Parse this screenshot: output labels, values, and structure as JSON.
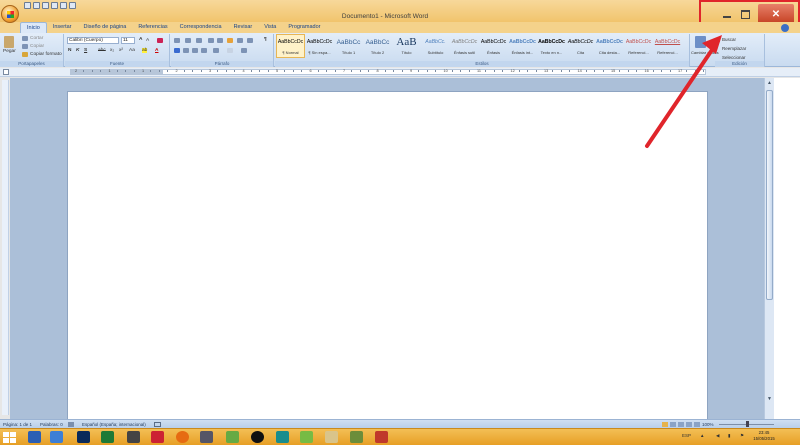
{
  "window": {
    "title": "Documento1 - Microsoft Word",
    "close_glyph": "✕"
  },
  "tabs": [
    "Inicio",
    "Insertar",
    "Diseño de página",
    "Referencias",
    "Correspondencia",
    "Revisar",
    "Vista",
    "Programador"
  ],
  "ribbon": {
    "clipboard": {
      "paste": "Pegar",
      "cut": "Cortar",
      "copy": "Copiar",
      "format_painter": "Copiar formato",
      "label": "Portapapeles"
    },
    "font": {
      "name": "Calibri (Cuerpo)",
      "size": "11",
      "label": "Fuente",
      "grow": "A",
      "shrink": "A",
      "bold": "N",
      "italic": "K",
      "underline": "S",
      "strike": "abc",
      "sub": "x₂",
      "sup": "x²",
      "case": "Aa",
      "highlight": "ab",
      "color": "A"
    },
    "paragraph": {
      "label": "Párrafo",
      "show_marks": "¶"
    },
    "styles": {
      "label": "Estilos",
      "items": [
        {
          "preview": "AaBbCcDc",
          "name": "¶ Normal"
        },
        {
          "preview": "AaBbCcDc",
          "name": "¶ Sin espa..."
        },
        {
          "preview": "AaBbCc",
          "name": "Título 1"
        },
        {
          "preview": "AaBbCc",
          "name": "Título 2"
        },
        {
          "preview": "AaB",
          "name": "Título"
        },
        {
          "preview": "AaBbCc.",
          "name": "Subtítulo"
        },
        {
          "preview": "AaBbCcDc",
          "name": "Énfasis sutil"
        },
        {
          "preview": "AaBbCcDc",
          "name": "Énfasis"
        },
        {
          "preview": "AaBbCcDc",
          "name": "Énfasis int..."
        },
        {
          "preview": "AaBbCcDc",
          "name": "Texto en n..."
        },
        {
          "preview": "AaBbCcDc",
          "name": "Cita"
        },
        {
          "preview": "AaBbCcDc",
          "name": "Cita desta..."
        },
        {
          "preview": "AaBbCcDc",
          "name": "Referenci..."
        },
        {
          "preview": "AaBbCcDc",
          "name": "Referenci..."
        }
      ],
      "change_styles": "Cambiar estilos"
    },
    "editing": {
      "find": "Buscar",
      "replace": "Reemplazar",
      "select": "Seleccionar",
      "label": "Edición"
    }
  },
  "ruler": {
    "numbers": [
      "2",
      "1",
      "1",
      "2",
      "3",
      "4",
      "5",
      "6",
      "7",
      "8",
      "9",
      "10",
      "11",
      "12",
      "13",
      "14",
      "15",
      "16",
      "17"
    ]
  },
  "status": {
    "page": "Página: 1 de 1",
    "words": "Palabras: 0",
    "language": "Español (España; internacional)",
    "zoom": "100%"
  },
  "taskbar": {
    "time": "23:45",
    "date": "15/05/2015",
    "keyboard": "ESP"
  },
  "colors": {
    "titlebar": "#f1c46c",
    "ribbon": "#dce8f7",
    "annotation": "#e0252b",
    "taskbar": "#e79f25"
  }
}
